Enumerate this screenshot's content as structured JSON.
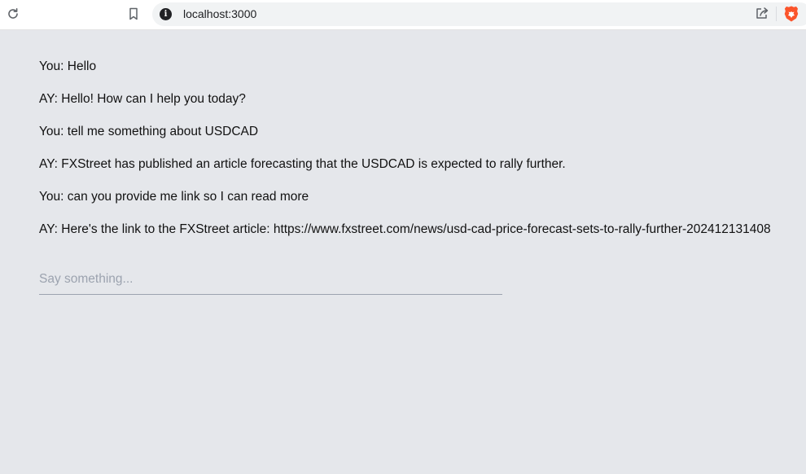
{
  "browser": {
    "url": "localhost:3000",
    "brand_color": "#fb542b"
  },
  "chat": {
    "messages": [
      {
        "text": "You: Hello"
      },
      {
        "text": "AY: Hello! How can I help you today?"
      },
      {
        "text": "You: tell me something about USDCAD"
      },
      {
        "text": "AY: FXStreet has published an article forecasting that the USDCAD is expected to rally further."
      },
      {
        "text": "You: can you provide me link so I can read more"
      },
      {
        "text": "AY: Here's the link to the FXStreet article: https://www.fxstreet.com/news/usd-cad-price-forecast-sets-to-rally-further-202412131408"
      }
    ],
    "input": {
      "placeholder": "Say something...",
      "value": ""
    }
  }
}
